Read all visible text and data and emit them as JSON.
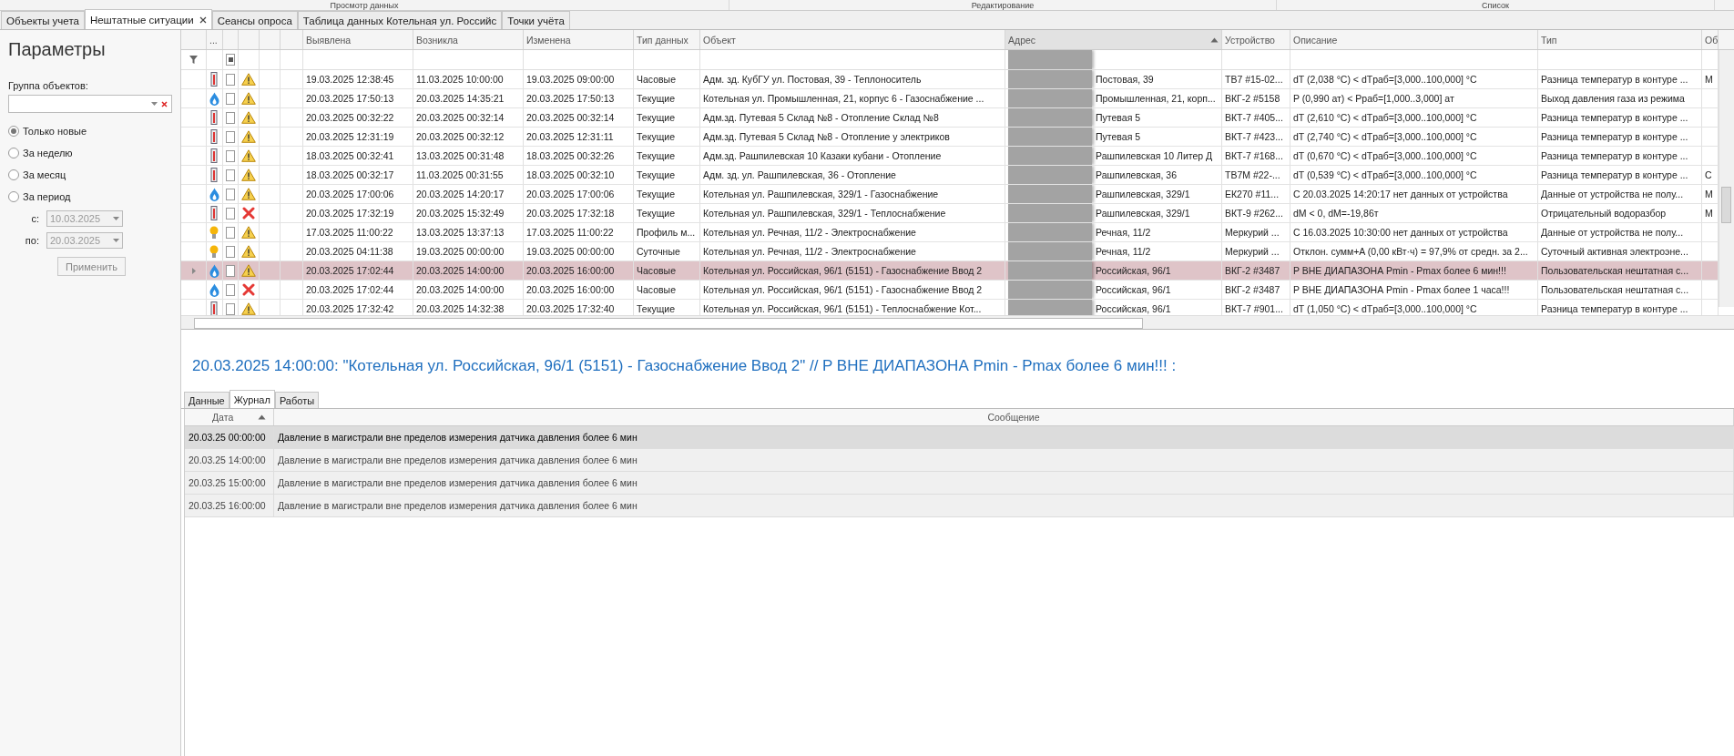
{
  "ribbon_groups": [
    "Просмотр данных",
    "Редактирование",
    "Список"
  ],
  "tabs": [
    {
      "label": "Объекты учета",
      "selected": false,
      "closable": false
    },
    {
      "label": "Нештатные ситуации",
      "selected": true,
      "closable": true
    },
    {
      "label": "Сеансы опроса",
      "selected": false,
      "closable": false
    },
    {
      "label": "Таблица данных Котельная ул. Российс",
      "selected": false,
      "closable": false
    },
    {
      "label": "Точки учёта",
      "selected": false,
      "closable": false
    }
  ],
  "sidebar": {
    "title": "Параметры",
    "group_label": "Группа объектов:",
    "periods": [
      {
        "label": "Только новые",
        "selected": true
      },
      {
        "label": "За неделю",
        "selected": false
      },
      {
        "label": "За месяц",
        "selected": false
      },
      {
        "label": "За период",
        "selected": false
      }
    ],
    "from_label": "с:",
    "from_value": "10.03.2025",
    "to_label": "по:",
    "to_value": "20.03.2025",
    "dates_disabled": true,
    "apply_button": "Применить"
  },
  "table": {
    "select_all_indeterminate": true,
    "columns": [
      {
        "label": "...",
        "sorted": false
      },
      {
        "label": "Выявлена",
        "sorted": false
      },
      {
        "label": "Возникла",
        "sorted": false
      },
      {
        "label": "Изменена",
        "sorted": false
      },
      {
        "label": "Тип данных",
        "sorted": false
      },
      {
        "label": "Объект",
        "sorted": false
      },
      {
        "label": "Адрес",
        "sorted": true
      },
      {
        "label": "Устройство",
        "sorted": false
      },
      {
        "label": "Описание",
        "sorted": false
      },
      {
        "label": "Тип",
        "sorted": false
      },
      {
        "label": "Об",
        "sorted": false
      }
    ],
    "rows": [
      {
        "sensor": {
          "kind": "heat"
        },
        "status": {
          "kind": "warning"
        },
        "checked": false,
        "selected": false,
        "detected": "19.03.2025 12:38:45",
        "occurred": "11.03.2025 10:00:00",
        "changed": "19.03.2025 09:00:00",
        "data_type": "Часовые",
        "object": "Адм. зд. КубГУ ул. Постовая, 39 - Теплоноситель",
        "address": "Постовая, 39",
        "device": "ТВ7 #15-02...",
        "description": "dT (2,038 °C) < dTраб=[3,000..100,000] °C",
        "type": "Разница температур в контуре ...",
        "column_11": "М"
      },
      {
        "sensor": {
          "kind": "gas"
        },
        "status": {
          "kind": "warning"
        },
        "checked": false,
        "selected": false,
        "detected": "20.03.2025 17:50:13",
        "occurred": "20.03.2025 14:35:21",
        "changed": "20.03.2025 17:50:13",
        "data_type": "Текущие",
        "object": "Котельная ул. Промышленная, 21, корпус 6 - Газоснабжение ...",
        "address": "Промышленная, 21, корп...",
        "device": "ВКГ-2 #5158",
        "description": "P (0,990 ат) < Pраб=[1,000..3,000] ат",
        "type": "Выход давления газа из режима",
        "column_11": ""
      },
      {
        "sensor": {
          "kind": "heat"
        },
        "status": {
          "kind": "warning"
        },
        "checked": false,
        "selected": false,
        "detected": "20.03.2025 00:32:22",
        "occurred": "20.03.2025 00:32:14",
        "changed": "20.03.2025 00:32:14",
        "data_type": "Текущие",
        "object": "Адм.зд. Путевая 5 Склад №8 - Отопление Склад №8",
        "address": "Путевая 5",
        "device": "ВКТ-7 #405...",
        "description": "dT (2,610 °C) < dTраб=[3,000..100,000] °C",
        "type": "Разница температур в контуре ...",
        "column_11": ""
      },
      {
        "sensor": {
          "kind": "heat"
        },
        "status": {
          "kind": "warning"
        },
        "checked": false,
        "selected": false,
        "detected": "20.03.2025 12:31:19",
        "occurred": "20.03.2025 00:32:12",
        "changed": "20.03.2025 12:31:11",
        "data_type": "Текущие",
        "object": "Адм.зд. Путевая 5 Склад №8 - Отопление у электриков",
        "address": "Путевая 5",
        "device": "ВКТ-7 #423...",
        "description": "dT (2,740 °C) < dTраб=[3,000..100,000] °C",
        "type": "Разница температур в контуре ...",
        "column_11": ""
      },
      {
        "sensor": {
          "kind": "heat"
        },
        "status": {
          "kind": "warning"
        },
        "checked": false,
        "selected": false,
        "detected": "18.03.2025 00:32:41",
        "occurred": "13.03.2025 00:31:48",
        "changed": "18.03.2025 00:32:26",
        "data_type": "Текущие",
        "object": "Адм.зд. Рашпилевская 10  Казаки кубани - Отопление",
        "address": "Рашпилевская 10 Литер Д",
        "device": "ВКТ-7 #168...",
        "description": "dT (0,670 °C) < dTраб=[3,000..100,000] °C",
        "type": "Разница температур в контуре ...",
        "column_11": ""
      },
      {
        "sensor": {
          "kind": "heat"
        },
        "status": {
          "kind": "warning"
        },
        "checked": false,
        "selected": false,
        "detected": "18.03.2025 00:32:17",
        "occurred": "11.03.2025 00:31:55",
        "changed": "18.03.2025 00:32:10",
        "data_type": "Текущие",
        "object": "Адм. зд. ул. Рашпилевская, 36 - Отопление",
        "address": "Рашпилевская, 36",
        "device": "ТВ7М #22-...",
        "description": "dT (0,539 °C) < dTраб=[3,000..100,000] °C",
        "type": "Разница температур в контуре ...",
        "column_11": "С"
      },
      {
        "sensor": {
          "kind": "gas"
        },
        "status": {
          "kind": "warning"
        },
        "checked": false,
        "selected": false,
        "detected": "20.03.2025 17:00:06",
        "occurred": "20.03.2025 14:20:17",
        "changed": "20.03.2025 17:00:06",
        "data_type": "Текущие",
        "object": "Котельная ул. Рашпилевская, 329/1 - Газоснабжение",
        "address": "Рашпилевская, 329/1",
        "device": "ЕК270 #11...",
        "description": "С 20.03.2025 14:20:17 нет данных от устройства",
        "type": "Данные от устройства не полу...",
        "column_11": "М"
      },
      {
        "sensor": {
          "kind": "heat"
        },
        "status": {
          "kind": "error"
        },
        "checked": false,
        "selected": false,
        "detected": "20.03.2025 17:32:19",
        "occurred": "20.03.2025 15:32:49",
        "changed": "20.03.2025 17:32:18",
        "data_type": "Текущие",
        "object": "Котельная ул. Рашпилевская, 329/1 - Теплоснабжение",
        "address": "Рашпилевская, 329/1",
        "device": "ВКТ-9 #262...",
        "description": "dM < 0, dM=-19,86т",
        "type": "Отрицательный водоразбор",
        "column_11": "М"
      },
      {
        "sensor": {
          "kind": "power"
        },
        "status": {
          "kind": "warning"
        },
        "checked": false,
        "selected": false,
        "detected": "17.03.2025 11:00:22",
        "occurred": "13.03.2025 13:37:13",
        "changed": "17.03.2025 11:00:22",
        "data_type": "Профиль м...",
        "object": "Котельная ул. Речная, 11/2 - Электроснабжение",
        "address": "Речная, 11/2",
        "device": "Меркурий ...",
        "description": "С 16.03.2025 10:30:00 нет данных от устройства",
        "type": "Данные от устройства не полу...",
        "column_11": ""
      },
      {
        "sensor": {
          "kind": "power"
        },
        "status": {
          "kind": "warning"
        },
        "checked": false,
        "selected": false,
        "detected": "20.03.2025 04:11:38",
        "occurred": "19.03.2025 00:00:00",
        "changed": "19.03.2025 00:00:00",
        "data_type": "Суточные",
        "object": "Котельная ул. Речная, 11/2 - Электроснабжение",
        "address": "Речная, 11/2",
        "device": "Меркурий ...",
        "description": "Отклон. сумм+A (0,00 кВт·ч) = 97,9% от средн. за 2...",
        "type": "Суточный активная электроэне...",
        "column_11": ""
      },
      {
        "sensor": {
          "kind": "gas"
        },
        "status": {
          "kind": "warning"
        },
        "checked": false,
        "selected": true,
        "detected": "20.03.2025 17:02:44",
        "occurred": "20.03.2025 14:00:00",
        "changed": "20.03.2025 16:00:00",
        "data_type": "Часовые",
        "object": "Котельная ул. Российская, 96/1 (5151) - Газоснабжение Ввод 2",
        "address": "Российская, 96/1",
        "device": "ВКГ-2 #3487",
        "description": "P ВНЕ ДИАПАЗОНА Pmin - Pmax более 6 мин!!!",
        "type": "Пользовательская нештатная с...",
        "column_11": ""
      },
      {
        "sensor": {
          "kind": "gas"
        },
        "status": {
          "kind": "error"
        },
        "checked": false,
        "selected": false,
        "detected": "20.03.2025 17:02:44",
        "occurred": "20.03.2025 14:00:00",
        "changed": "20.03.2025 16:00:00",
        "data_type": "Часовые",
        "object": "Котельная ул. Российская, 96/1 (5151) - Газоснабжение Ввод 2",
        "address": "Российская, 96/1",
        "device": "ВКГ-2 #3487",
        "description": "P ВНЕ ДИАПАЗОНА Pmin - Pmax более 1 часа!!!",
        "type": "Пользовательская нештатная с...",
        "column_11": ""
      },
      {
        "sensor": {
          "kind": "heat"
        },
        "status": {
          "kind": "warning"
        },
        "checked": false,
        "selected": false,
        "detected": "20.03.2025 17:32:42",
        "occurred": "20.03.2025 14:32:38",
        "changed": "20.03.2025 17:32:40",
        "data_type": "Текущие",
        "object": "Котельная ул. Российская, 96/1 (5151) - Теплоснабжение Кот...",
        "address": "Российская, 96/1",
        "device": "ВКТ-7 #901...",
        "description": "dT (1,050 °C) < dTраб=[3,000..100,000] °C",
        "type": "Разница температур в контуре ...",
        "column_11": ""
      }
    ]
  },
  "detail": {
    "title": "20.03.2025 14:00:00: \"Котельная ул. Российская, 96/1 (5151) - Газоснабжение Ввод 2\" // P ВНЕ ДИАПАЗОНА Pmin - Pmax более 6 мин!!! :",
    "tabs": [
      {
        "label": "Данные",
        "selected": false
      },
      {
        "label": "Журнал",
        "selected": true
      },
      {
        "label": "Работы",
        "selected": false
      }
    ],
    "columns": [
      {
        "label": "Дата",
        "sorted": true
      },
      {
        "label": "Сообщение",
        "sorted": false
      }
    ],
    "rows": [
      {
        "date": "20.03.25 00:00:00",
        "message": "Давление в магистрали вне пределов измерения датчика давления более 6 мин",
        "selected": true
      },
      {
        "date": "20.03.25 14:00:00",
        "message": "Давление в магистрали вне пределов измерения датчика давления более 6 мин",
        "selected": false
      },
      {
        "date": "20.03.25 15:00:00",
        "message": "Давление в магистрали вне пределов измерения датчика давления более 6 мин",
        "selected": false
      },
      {
        "date": "20.03.25 16:00:00",
        "message": "Давление в магистрали вне пределов измерения датчика давления более 6 мин",
        "selected": false
      }
    ]
  }
}
